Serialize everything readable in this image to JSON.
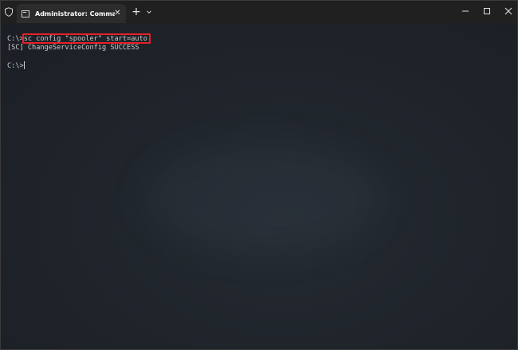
{
  "tab": {
    "title": "Administrator: Command Prom",
    "icon": "terminal-icon",
    "close_label": "✕"
  },
  "titlebar": {
    "new_tab_label": "+",
    "icons": [
      "shield-icon",
      "chevron-down-icon",
      "minimize-icon",
      "maximize-icon",
      "close-icon"
    ]
  },
  "terminal": {
    "prompt_1": "C:\\>",
    "command": "sc config \"spooler\" start=auto",
    "output": "[SC] ChangeServiceConfig SUCCESS",
    "prompt_2": "C:\\>"
  },
  "colors": {
    "titlebar_bg": "#202020",
    "tab_bg": "#2c2c2c",
    "terminal_text": "#cccccc",
    "highlight_border": "#e8202a"
  }
}
